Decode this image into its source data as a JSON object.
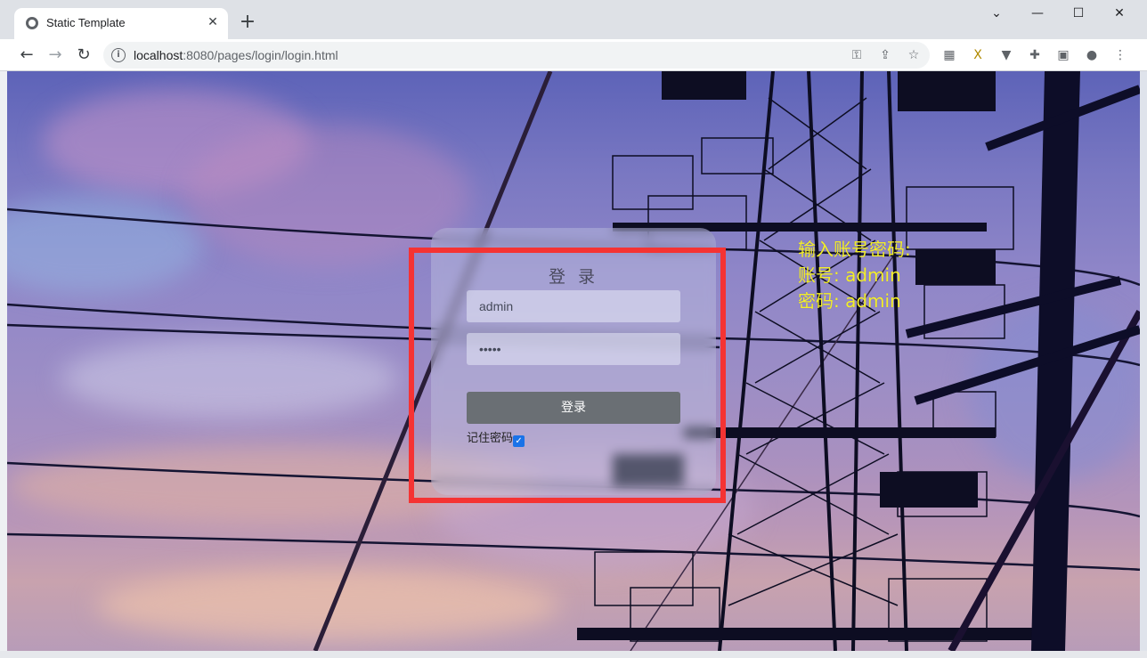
{
  "browser": {
    "tab_title": "Static Template",
    "tab_close": "✕",
    "new_tab": "+",
    "url_host": "localhost",
    "url_path": ":8080/pages/login/login.html",
    "window_controls": {
      "dropdown": "⌄",
      "minimize": "—",
      "maximize": "☐",
      "close": "✕"
    },
    "nav": {
      "back": "←",
      "forward": "→",
      "reload": "↻"
    },
    "omnibox_icons": [
      "key-icon",
      "share-icon",
      "star-icon"
    ],
    "extension_icons": [
      "extension-1-icon",
      "extension-x-icon",
      "extension-v-icon",
      "puzzle-icon",
      "sidebar-icon",
      "profile-icon",
      "menu-icon"
    ]
  },
  "login": {
    "title": "登 录",
    "username_value": "admin",
    "password_value": "•••••",
    "submit_label": "登录",
    "remember_label": "记住密码",
    "remember_checked": true
  },
  "hint": {
    "line1": "输入账号密码:",
    "line2": "账号: admin",
    "line3": "密码: admin"
  },
  "colors": {
    "highlight": "#f53333",
    "hint_text": "#f3ee2a"
  }
}
